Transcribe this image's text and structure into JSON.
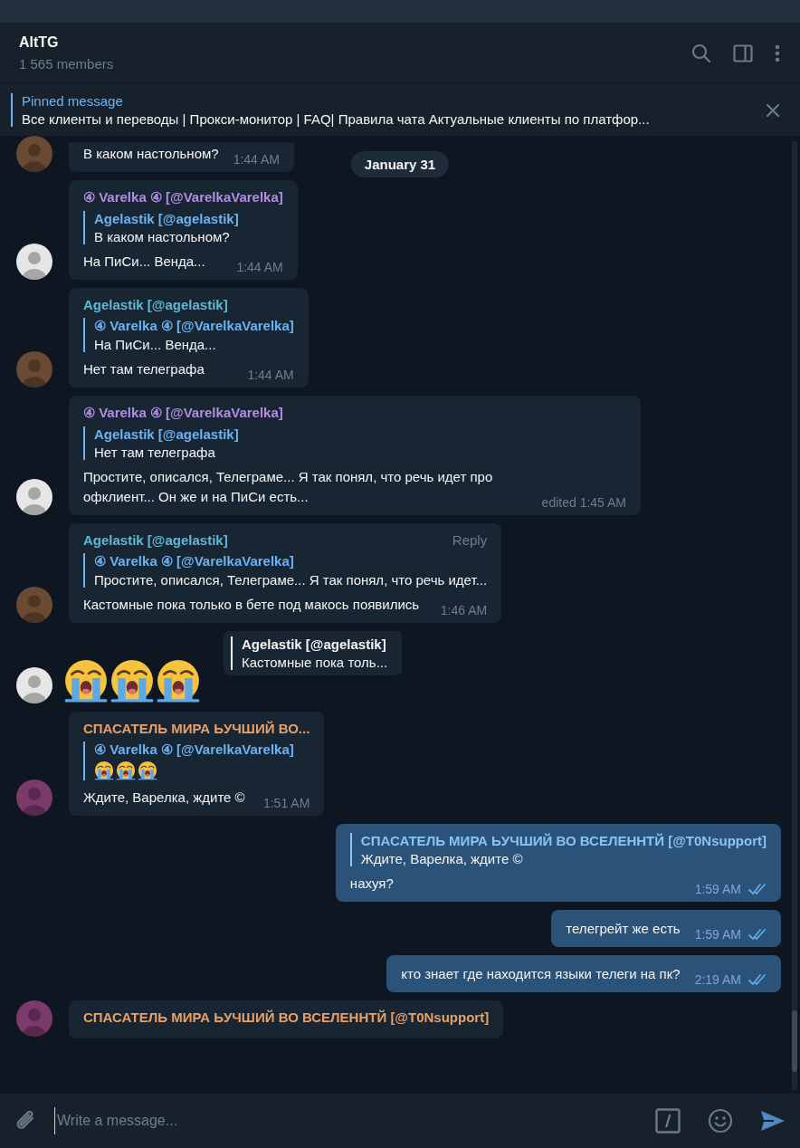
{
  "chat": {
    "title": "AltTG",
    "subtitle": "1 565 members"
  },
  "pinned": {
    "label": "Pinned message",
    "text": "Все клиенты и переводы | Прокси-монитор | FAQ| Правила чата  Актуальные клиенты по платфор..."
  },
  "date_badge": "January 31",
  "messages": [
    {
      "kind": "incoming",
      "avatar": {
        "color": "#6b4a33"
      },
      "text": "В каком настольном?",
      "time": "1:44 AM"
    },
    {
      "kind": "incoming",
      "avatar": {
        "color": "#e6e6e6"
      },
      "sender": {
        "name": "④ Varelka ④ [@VarelkaVarelka]",
        "color": "#b28de0"
      },
      "reply": {
        "author": "Agelastik [@agelastik]",
        "text": "В каком настольном?"
      },
      "text": "На ПиСи... Венда...",
      "time": "1:44 AM"
    },
    {
      "kind": "incoming",
      "avatar": {
        "color": "#6b4a33"
      },
      "sender": {
        "name": "Agelastik [@agelastik]",
        "color": "#5cbad6"
      },
      "reply": {
        "author": "④ Varelka ④ [@VarelkaVarelka]",
        "text": "На ПиСи... Венда..."
      },
      "text": "Нет там телеграфа",
      "time": "1:44 AM"
    },
    {
      "kind": "incoming",
      "avatar": {
        "color": "#e6e6e6"
      },
      "sender": {
        "name": "④ Varelka ④ [@VarelkaVarelka]",
        "color": "#b28de0"
      },
      "reply": {
        "author": "Agelastik [@agelastik]",
        "text": "Нет там телеграфа"
      },
      "text": "Простите, описался, Телеграме... Я так понял, что речь идет про офклиент... Он же и на ПиСи есть...",
      "time": "edited 1:45 AM"
    },
    {
      "kind": "incoming",
      "avatar": {
        "color": "#6b4a33"
      },
      "sender": {
        "name": "Agelastik [@agelastik]",
        "color": "#5cbad6"
      },
      "action": "Reply",
      "reply": {
        "author": "④ Varelka ④ [@VarelkaVarelka]",
        "text": "Простите, описался, Телеграме... Я так понял, что речь идет..."
      },
      "text": "Кастомные пока только в бете под макось появились",
      "time": "1:46 AM"
    },
    {
      "kind": "sticker",
      "avatar": {
        "color": "#e6e6e6"
      },
      "stickers": [
        {
          "kind": "crying"
        },
        {
          "kind": "crying"
        },
        {
          "kind": "crying"
        }
      ],
      "reply": {
        "author": "Agelastik [@agelastik]",
        "text": "Кастомные пока толь..."
      }
    },
    {
      "kind": "incoming",
      "avatar": {
        "color": "#7a3a6a"
      },
      "sender": {
        "name": "СПАСАТЕЛЬ МИРА ЬУЧШИЙ ВО...",
        "color": "#e8a064"
      },
      "reply": {
        "author": "④ Varelka ④ [@VarelkaVarelka]",
        "emojis": [
          {
            "kind": "crying"
          },
          {
            "kind": "crying"
          },
          {
            "kind": "crying"
          }
        ]
      },
      "text": "Ждите, Варелка, ждите ©",
      "time": "1:51 AM"
    },
    {
      "kind": "outgoing",
      "reply": {
        "author": "СПАСАТЕЛЬ МИРА ЬУЧШИЙ ВО ВСЕЛЕННТЙ [@T0Nsupport]",
        "text": "Ждите, Варелка, ждите ©"
      },
      "text": "нахуя?",
      "time": "1:59 AM",
      "read": true
    },
    {
      "kind": "outgoing",
      "text": "телегрейт же есть",
      "time": "1:59 AM",
      "read": true
    },
    {
      "kind": "outgoing",
      "text": "кто знает где находится языки телеги на пк?",
      "time": "2:19 AM",
      "read": true
    },
    {
      "kind": "incoming",
      "avatar": {
        "color": "#7a3a6a"
      },
      "sender": {
        "name": "СПАСАТЕЛЬ МИРА ЬУЧШИЙ ВО ВСЕЛЕННТЙ [@T0Nsupport]",
        "color": "#e8a064"
      }
    }
  ],
  "composer": {
    "placeholder": "Write a message..."
  }
}
